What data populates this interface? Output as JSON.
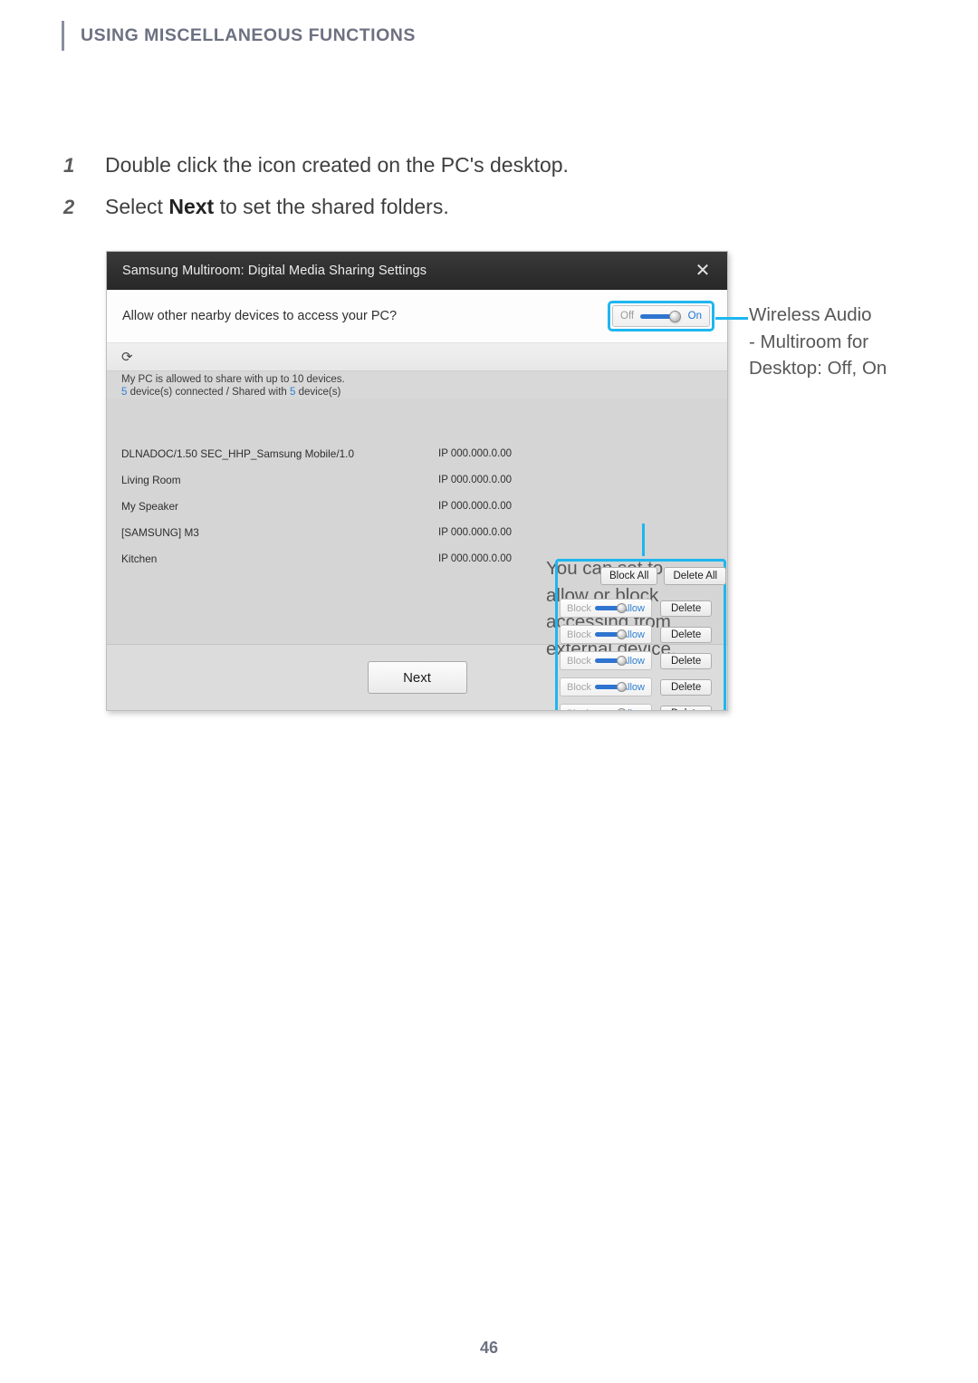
{
  "runhead": {
    "title": "USING MISCELLANEOUS FUNCTIONS"
  },
  "steps": [
    {
      "num": "1",
      "text": "Double click the icon created on the PC's desktop."
    },
    {
      "num": "2",
      "text_before": "Select ",
      "bold": "Next",
      "text_after": " to set the shared folders."
    }
  ],
  "dialog": {
    "title": "Samsung Multiroom: Digital Media Sharing Settings",
    "close_icon": "✕",
    "allow_question": "Allow other nearby devices to access your PC?",
    "master_toggle": {
      "off_label": "Off",
      "on_label": "On",
      "state": "On"
    },
    "refresh_icon": "⟳",
    "info": {
      "line1": "My PC is allowed to share with up to 10 devices.",
      "connected_count": "5",
      "line2_mid": " device(s) connected / Shared with ",
      "shared_count": "5",
      "line2_end": " device(s)"
    },
    "bulk_actions": {
      "block_all": "Block All",
      "delete_all": "Delete All"
    },
    "row_labels": {
      "block": "Block",
      "allow": "Allow",
      "delete": "Delete"
    },
    "devices": [
      {
        "name": "DLNADOC/1.50 SEC_HHP_Samsung Mobile/1.0",
        "ip": "IP 000.000.0.00",
        "state": "Allow"
      },
      {
        "name": "Living Room",
        "ip": "IP 000.000.0.00",
        "state": "Allow"
      },
      {
        "name": "My Speaker",
        "ip": "IP 000.000.0.00",
        "state": "Allow"
      },
      {
        "name": "[SAMSUNG] M3",
        "ip": "IP 000.000.0.00",
        "state": "Allow"
      },
      {
        "name": "Kitchen",
        "ip": "IP 000.000.0.00",
        "state": "Allow"
      }
    ],
    "next_label": "Next"
  },
  "callouts": {
    "right": "Wireless Audio - Multiroom for Desktop: Off, On",
    "right_lines": [
      "Wireless Audio",
      "- Multiroom for",
      "Desktop: Off, On"
    ],
    "bottom": "You can set to allow or block accessing from external device.",
    "bottom_lines": [
      "You can set to",
      "allow or block",
      "accessing from",
      "external device."
    ]
  },
  "footer": {
    "page_number": "46"
  },
  "colors": {
    "accent_callout": "#1fb6ef",
    "heading": "#6c7182",
    "toggle_on": "#2f74d0",
    "link_blue": "#2f7fd0"
  }
}
